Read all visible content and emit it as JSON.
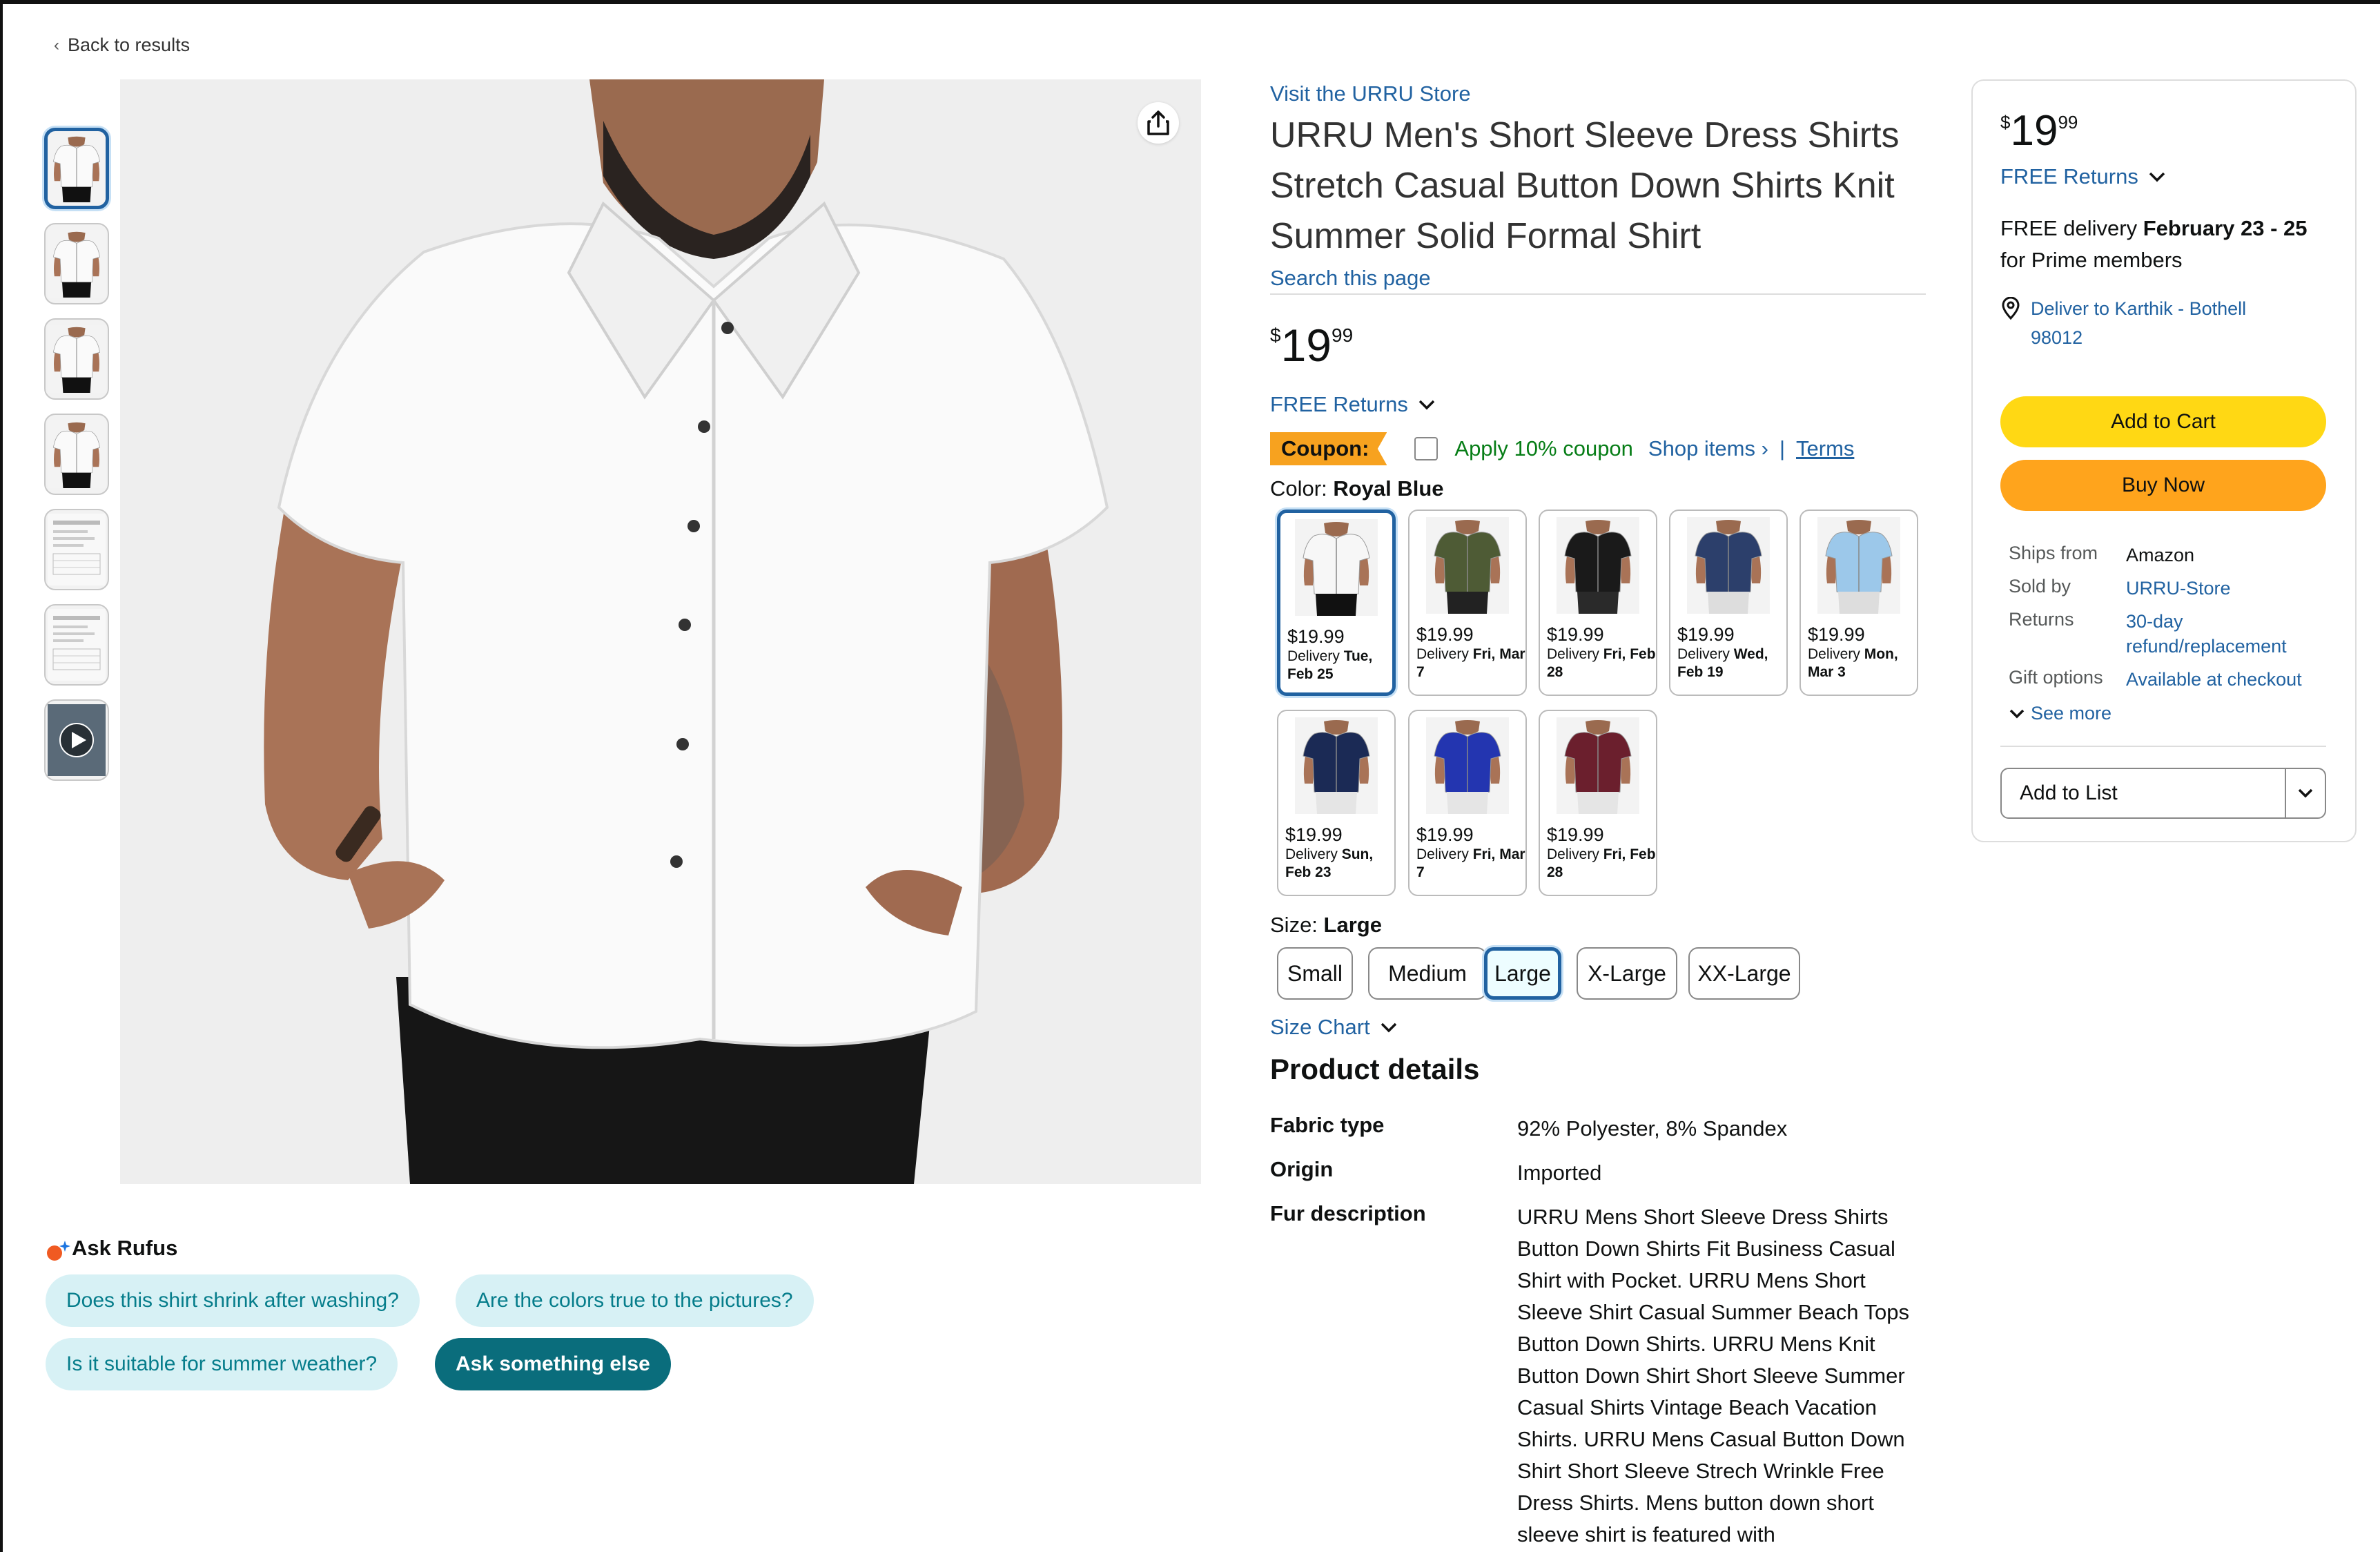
{
  "nav": {
    "back_label": "Back to results"
  },
  "thumbnails": [
    {
      "kind": "shirt",
      "color": "#f4f4f4"
    },
    {
      "kind": "shirt",
      "color": "#f4f4f4"
    },
    {
      "kind": "shirt",
      "color": "#f4f4f4"
    },
    {
      "kind": "shirt",
      "color": "#f4f4f4"
    },
    {
      "kind": "chart",
      "color": "#f4f4f4"
    },
    {
      "kind": "chart",
      "color": "#f4f4f4"
    },
    {
      "kind": "video",
      "color": "#333333"
    }
  ],
  "rufus": {
    "title": "Ask Rufus",
    "questions": [
      "Does this shirt shrink after washing?",
      "Are the colors true to the pictures?",
      "Is it suitable for summer weather?"
    ],
    "ask_else": "Ask something else"
  },
  "product": {
    "store_link": "Visit the URRU Store",
    "title": "URRU Men's Short Sleeve Dress Shirts Stretch Casual Button Down Shirts Knit Summer Solid Formal Shirt",
    "search_page": "Search this page",
    "price": {
      "symbol": "$",
      "whole": "19",
      "fraction": "99"
    },
    "free_returns": "FREE Returns",
    "coupon": {
      "tag": "Coupon:",
      "text": "Apply 10% coupon",
      "shop_items": "Shop items ›",
      "separator": "|",
      "terms": "Terms"
    },
    "color": {
      "label": "Color:",
      "selected": "Royal Blue",
      "options": [
        {
          "price": "$19.99",
          "delivery_prefix": "Delivery",
          "delivery_date": "Tue, Feb 25",
          "shirt": "#f7f7f7",
          "pants": "#111111"
        },
        {
          "price": "$19.99",
          "delivery_prefix": "Delivery",
          "delivery_date": "Fri, Mar 7",
          "shirt": "#4e5b35",
          "pants": "#222222"
        },
        {
          "price": "$19.99",
          "delivery_prefix": "Delivery",
          "delivery_date": "Fri, Feb 28",
          "shirt": "#1a1a1a",
          "pants": "#2a2a2a"
        },
        {
          "price": "$19.99",
          "delivery_prefix": "Delivery",
          "delivery_date": "Wed, Feb 19",
          "shirt": "#2c3f6b",
          "pants": "#dddddd"
        },
        {
          "price": "$19.99",
          "delivery_prefix": "Delivery",
          "delivery_date": "Mon, Mar 3",
          "shirt": "#9cc8ea",
          "pants": "#dddddd"
        },
        {
          "price": "$19.99",
          "delivery_prefix": "Delivery",
          "delivery_date": "Sun, Feb 23",
          "shirt": "#1b2a55",
          "pants": "#e5e5e5"
        },
        {
          "price": "$19.99",
          "delivery_prefix": "Delivery",
          "delivery_date": "Fri, Mar 7",
          "shirt": "#2335b0",
          "pants": "#e5e5e5"
        },
        {
          "price": "$19.99",
          "delivery_prefix": "Delivery",
          "delivery_date": "Fri, Feb 28",
          "shirt": "#6b1f2d",
          "pants": "#e5e5e5"
        }
      ]
    },
    "size": {
      "label": "Size:",
      "selected": "Large",
      "options": [
        "Small",
        "Medium",
        "Large",
        "X-Large",
        "XX-Large"
      ]
    },
    "size_chart": "Size Chart",
    "details": {
      "title": "Product details",
      "rows": [
        {
          "key": "Fabric type",
          "value": "92% Polyester, 8% Spandex"
        },
        {
          "key": "Origin",
          "value": "Imported"
        },
        {
          "key": "Fur description",
          "value": "URRU Mens Short Sleeve Dress Shirts Button Down Shirts Fit Business Casual Shirt with Pocket. URRU Mens Short Sleeve Shirt Casual Summer Beach Tops Button Down Shirts. URRU Mens Knit Button Down Shirt Short Sleeve Summer Casual Shirts Vintage Beach Vacation Shirts. URRU Mens Casual Button Down Shirt Short Sleeve Strech Wrinkle Free Dress Shirts. Mens button down short sleeve shirt is featured with"
        }
      ]
    }
  },
  "buybox": {
    "price": {
      "symbol": "$",
      "whole": "19",
      "fraction": "99"
    },
    "free_returns": "FREE Returns",
    "delivery_prefix": "FREE delivery",
    "delivery_dates": "February 23 - 25",
    "delivery_suffix": "for Prime members",
    "deliver_to": "Deliver to Karthik - Bothell 98012",
    "add_to_cart": "Add to Cart",
    "buy_now": "Buy Now",
    "info": [
      {
        "key": "Ships from",
        "value": "Amazon",
        "link": false
      },
      {
        "key": "Sold by",
        "value": "URRU-Store",
        "link": true
      },
      {
        "key": "Returns",
        "value": "30-day refund/replacement",
        "link": true
      },
      {
        "key": "Gift options",
        "value": "Available at checkout",
        "link": true
      }
    ],
    "see_more": "See more",
    "add_to_list": "Add to List"
  },
  "colors": {
    "link": "#2162a1",
    "coupon_green": "#067d16",
    "cart_yellow": "#ffd814",
    "buy_orange": "#ffa41c",
    "rufus_chip": "#d7f1f5",
    "rufus_dark": "#0a6d7c",
    "selected_border": "#2162a1"
  },
  "icons": {
    "share": "share-icon",
    "location": "location-pin-icon",
    "chevron": "chevron-down-icon",
    "rufus": "rufus-sparkle-icon",
    "play": "play-icon"
  }
}
